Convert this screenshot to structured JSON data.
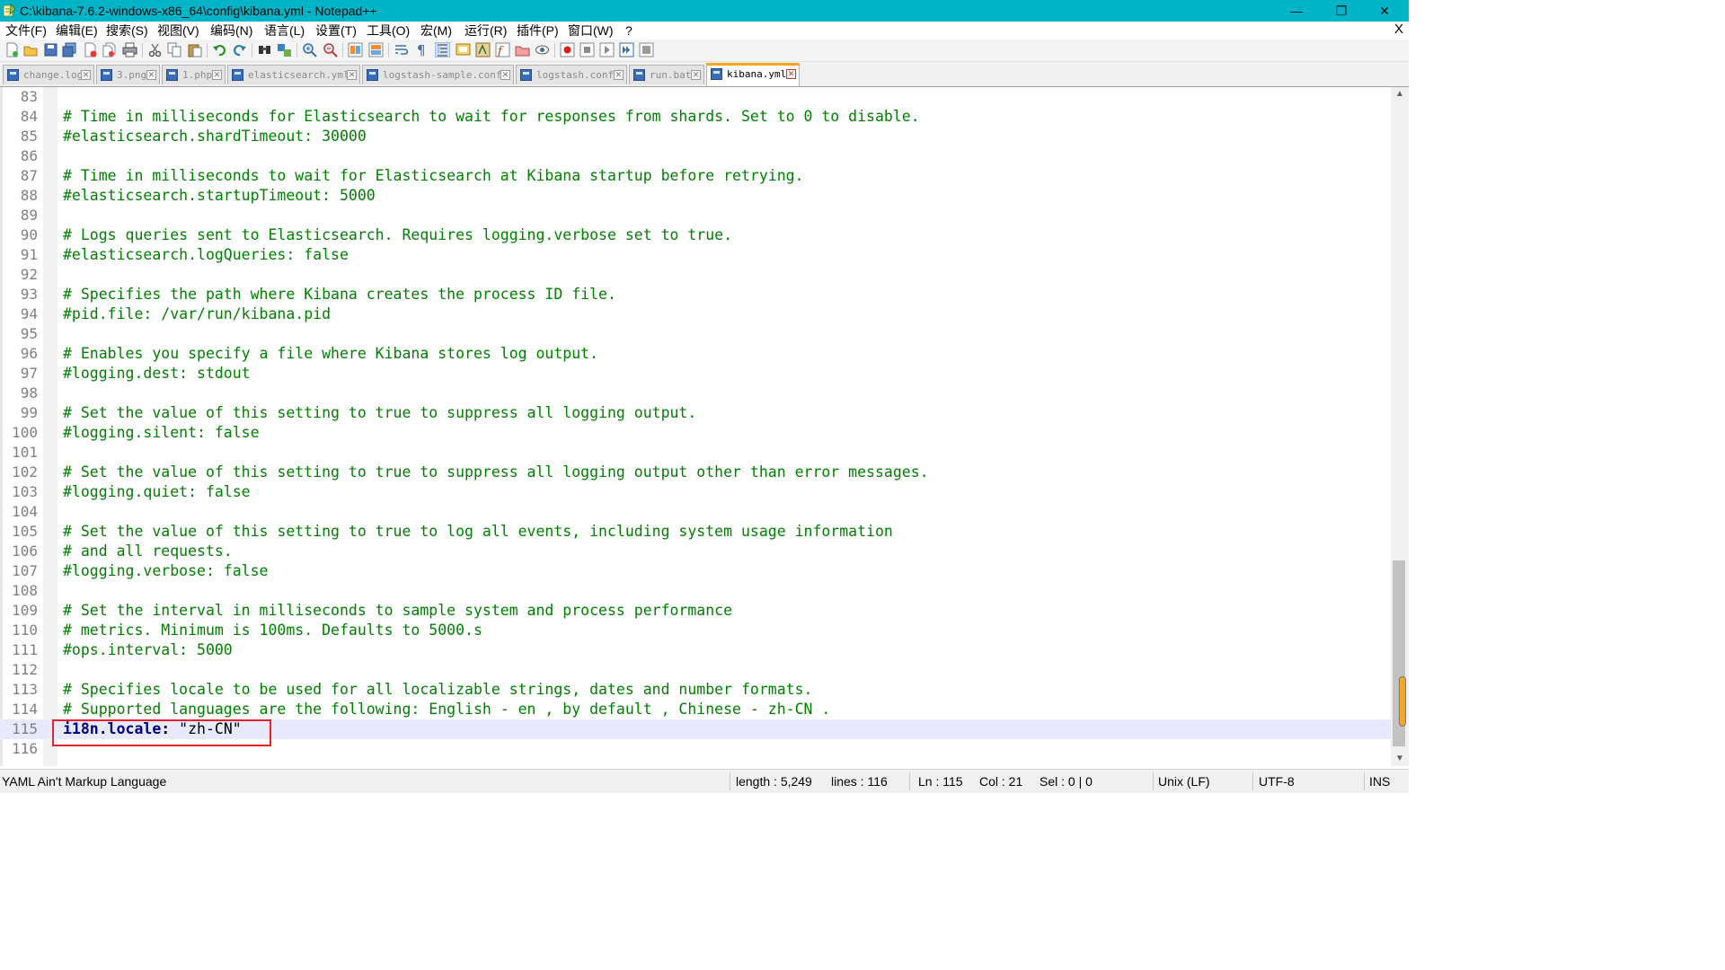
{
  "window": {
    "title": "C:\\kibana-7.6.2-windows-x86_64\\config\\kibana.yml - Notepad++",
    "minimize": "—",
    "restore": "❐",
    "close": "✕"
  },
  "menu": {
    "items": [
      "文件(F)",
      "编辑(E)",
      "搜索(S)",
      "视图(V)",
      "编码(N)",
      "语言(L)",
      "设置(T)",
      "工具(O)",
      "宏(M)",
      "运行(R)",
      "插件(P)",
      "窗口(W)",
      "?"
    ],
    "close_doc": "X"
  },
  "toolbar": {
    "icons": [
      "new-file-icon",
      "open-file-icon",
      "save-icon",
      "save-all-icon",
      "close-icon",
      "close-all-icon",
      "print-icon",
      "cut-icon",
      "copy-icon",
      "paste-icon",
      "undo-icon",
      "redo-icon",
      "find-icon",
      "replace-icon",
      "zoom-in-icon",
      "zoom-out-icon",
      "sync-vertical-icon",
      "sync-horizontal-icon",
      "word-wrap-icon",
      "show-all-chars-icon",
      "indent-guide-icon",
      "language-icon",
      "doc-map-icon",
      "function-list-icon",
      "folder-workspace-icon",
      "monitor-icon",
      "record-macro-icon",
      "stop-macro-icon",
      "play-macro-icon",
      "run-macro-multiple-icon",
      "save-macro-icon"
    ]
  },
  "tabs": [
    {
      "label": "change.log",
      "active": false
    },
    {
      "label": "3.png",
      "active": false
    },
    {
      "label": "1.php",
      "active": false
    },
    {
      "label": "elasticsearch.yml",
      "active": false
    },
    {
      "label": "logstash-sample.conf",
      "active": false
    },
    {
      "label": "logstash.conf",
      "active": false
    },
    {
      "label": "run.bat",
      "active": false
    },
    {
      "label": "kibana.yml",
      "active": true
    }
  ],
  "editor": {
    "lines": [
      {
        "n": "83",
        "text": ""
      },
      {
        "n": "84",
        "text": "# Time in milliseconds for Elasticsearch to wait for responses from shards. Set to 0 to disable."
      },
      {
        "n": "85",
        "text": "#elasticsearch.shardTimeout: 30000"
      },
      {
        "n": "86",
        "text": ""
      },
      {
        "n": "87",
        "text": "# Time in milliseconds to wait for Elasticsearch at Kibana startup before retrying."
      },
      {
        "n": "88",
        "text": "#elasticsearch.startupTimeout: 5000"
      },
      {
        "n": "89",
        "text": ""
      },
      {
        "n": "90",
        "text": "# Logs queries sent to Elasticsearch. Requires logging.verbose set to true."
      },
      {
        "n": "91",
        "text": "#elasticsearch.logQueries: false"
      },
      {
        "n": "92",
        "text": ""
      },
      {
        "n": "93",
        "text": "# Specifies the path where Kibana creates the process ID file."
      },
      {
        "n": "94",
        "text": "#pid.file: /var/run/kibana.pid"
      },
      {
        "n": "95",
        "text": ""
      },
      {
        "n": "96",
        "text": "# Enables you specify a file where Kibana stores log output."
      },
      {
        "n": "97",
        "text": "#logging.dest: stdout"
      },
      {
        "n": "98",
        "text": ""
      },
      {
        "n": "99",
        "text": "# Set the value of this setting to true to suppress all logging output."
      },
      {
        "n": "100",
        "text": "#logging.silent: false"
      },
      {
        "n": "101",
        "text": ""
      },
      {
        "n": "102",
        "text": "# Set the value of this setting to true to suppress all logging output other than error messages."
      },
      {
        "n": "103",
        "text": "#logging.quiet: false"
      },
      {
        "n": "104",
        "text": ""
      },
      {
        "n": "105",
        "text": "# Set the value of this setting to true to log all events, including system usage information"
      },
      {
        "n": "106",
        "text": "# and all requests."
      },
      {
        "n": "107",
        "text": "#logging.verbose: false"
      },
      {
        "n": "108",
        "text": ""
      },
      {
        "n": "109",
        "text": "# Set the interval in milliseconds to sample system and process performance"
      },
      {
        "n": "110",
        "text": "# metrics. Minimum is 100ms. Defaults to 5000.s"
      },
      {
        "n": "111",
        "text": "#ops.interval: 5000"
      },
      {
        "n": "112",
        "text": ""
      },
      {
        "n": "113",
        "text": "# Specifies locale to be used for all localizable strings, dates and number formats."
      },
      {
        "n": "114",
        "text": "# Supported languages are the following: English - en , by default , Chinese - zh-CN ."
      },
      {
        "n": "115",
        "key": "i18n.locale",
        "colon": ":",
        "value": " \"zh-CN\"",
        "current": true
      },
      {
        "n": "116",
        "text": ""
      }
    ]
  },
  "statusbar": {
    "language": "YAML Ain't Markup Language",
    "length": "length : 5,249",
    "lines": "lines : 116",
    "ln": "Ln : 115",
    "col": "Col : 21",
    "sel": "Sel : 0 | 0",
    "eol": "Unix (LF)",
    "encoding": "UTF-8",
    "mode": "INS"
  },
  "colors": {
    "titlebar": "#00b4c8",
    "comment": "#008000",
    "key": "#000080",
    "current_line": "#e8e8ff",
    "highlight_box": "#e0262c",
    "active_tab_accent": "#f5a623"
  }
}
